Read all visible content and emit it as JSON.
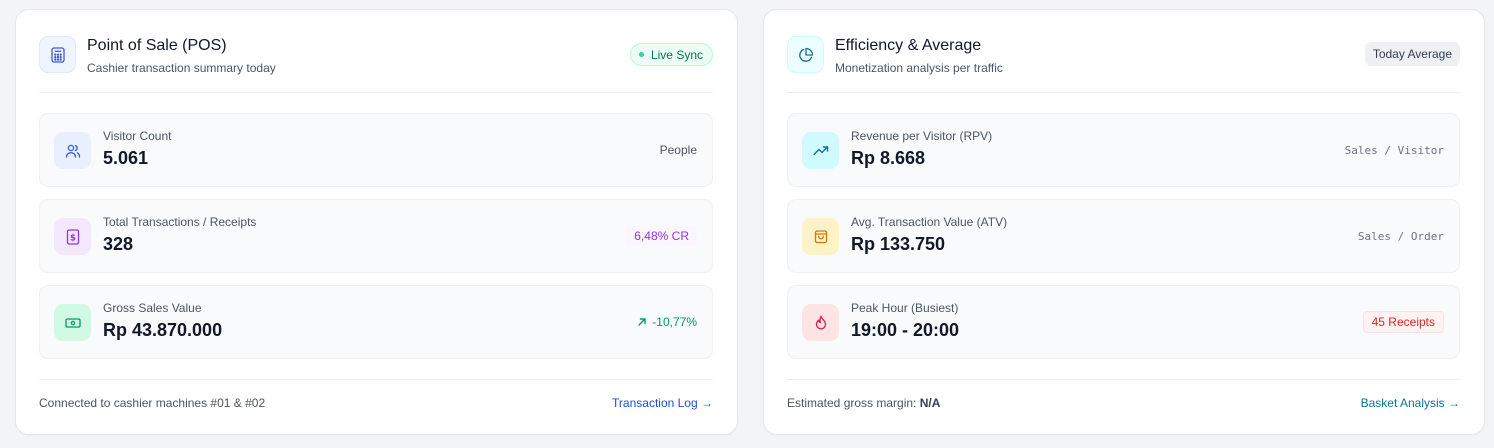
{
  "pos": {
    "title": "Point of Sale (POS)",
    "subtitle": "Cashier transaction summary today",
    "badge": "Live Sync",
    "rows": [
      {
        "label": "Visitor Count",
        "value": "5.061",
        "right": "People",
        "icon": "users-icon"
      },
      {
        "label": "Total Transactions / Receipts",
        "value": "328",
        "right": "6,48% CR",
        "icon": "receipt-icon"
      },
      {
        "label": "Gross Sales Value",
        "value": "Rp 43.870.000",
        "right": "-10,77%",
        "icon": "banknote-icon"
      }
    ],
    "footer": "Connected to cashier machines #01 & #02",
    "link": "Transaction Log →"
  },
  "efficiency": {
    "title": "Efficiency & Average",
    "subtitle": "Monetization analysis per traffic",
    "badge": "Today Average",
    "rows": [
      {
        "label": "Revenue per Visitor (RPV)",
        "value": "Rp 8.668",
        "right": "Sales / Visitor",
        "icon": "trending-up-icon"
      },
      {
        "label": "Avg. Transaction Value (ATV)",
        "value": "Rp 133.750",
        "right": "Sales / Order",
        "icon": "shopping-bag-icon"
      },
      {
        "label": "Peak Hour (Busiest)",
        "value": "19:00 - 20:00",
        "right": "45 Receipts",
        "icon": "flame-icon"
      }
    ],
    "footer_prefix": "Estimated gross margin:",
    "footer_value": "N/A",
    "link": "Basket Analysis →"
  },
  "colors": {
    "pos_accent": "#1d4ed8",
    "efficiency_accent": "#0e7490",
    "positive": "#059669",
    "purple": "#9333ea",
    "red": "#dc2626"
  }
}
